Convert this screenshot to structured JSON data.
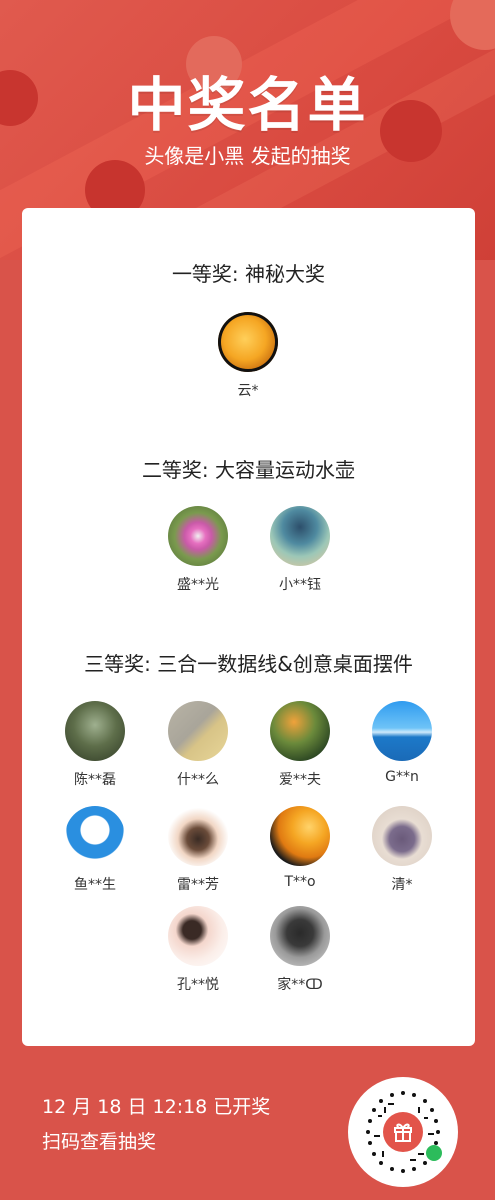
{
  "header": {
    "title": "中奖名单",
    "subtitle": "头像是小黑 发起的抽奖"
  },
  "prizes": [
    {
      "label": "一等奖: 神秘大奖",
      "winners": [
        {
          "name": "云*"
        }
      ]
    },
    {
      "label": "二等奖: 大容量运动水壶",
      "winners": [
        {
          "name": "盛**光"
        },
        {
          "name": "小**钰"
        }
      ]
    },
    {
      "label": "三等奖: 三合一数据线&创意桌面摆件",
      "winners": [
        {
          "name": "陈**磊"
        },
        {
          "name": "什**么"
        },
        {
          "name": "爱**夫"
        },
        {
          "name": "G**n"
        },
        {
          "name": "鱼**生"
        },
        {
          "name": "雷**芳"
        },
        {
          "name": "T**o"
        },
        {
          "name": "清*"
        },
        {
          "name": "孔**悦"
        },
        {
          "name": "家**ↀ"
        }
      ]
    }
  ],
  "footer": {
    "draw_time": "12 月 18 日 12:18 已开奖",
    "scan_text": "扫码查看抽奖"
  },
  "qr_icon": "gift-icon",
  "colors": {
    "background": "#d9534a",
    "accent": "#e2544a"
  }
}
